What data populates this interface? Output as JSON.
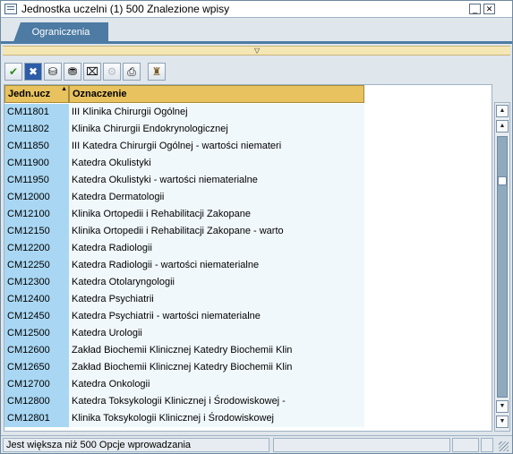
{
  "window": {
    "title": "Jednostka uczelni (1)  500 Znalezione wpisy",
    "minimize_glyph": "_",
    "close_glyph": "✕"
  },
  "tabs": [
    {
      "label": "Ograniczenia"
    }
  ],
  "collapse_bar": {
    "arrow_glyph": "▽"
  },
  "toolbar": {
    "buttons": [
      {
        "icon": "checkmark-icon",
        "glyph": "✔"
      },
      {
        "icon": "cancel-icon",
        "glyph": "✖"
      },
      {
        "icon": "find-icon",
        "glyph": "⛁"
      },
      {
        "icon": "find-next-icon",
        "glyph": "⛃"
      },
      {
        "icon": "delete-selection-icon",
        "glyph": "⌧"
      },
      {
        "icon": "info-icon",
        "glyph": "⚙"
      },
      {
        "icon": "print-icon",
        "glyph": "⎙"
      },
      {
        "icon": "personalize-icon",
        "glyph": "♜"
      }
    ]
  },
  "table": {
    "columns": [
      "Jedn.ucz",
      "Oznaczenie"
    ],
    "rows": [
      [
        "CM11801",
        "III Klinika Chirurgii Ogólnej"
      ],
      [
        "CM11802",
        "Klinika Chirurgii Endokrynologicznej"
      ],
      [
        "CM11850",
        "III Katedra Chirurgii Ogólnej - wartości niemateri"
      ],
      [
        "CM11900",
        "Katedra Okulistyki"
      ],
      [
        "CM11950",
        "Katedra Okulistyki - wartości niematerialne"
      ],
      [
        "CM12000",
        "Katedra Dermatologii"
      ],
      [
        "CM12100",
        "Klinika Ortopedii i Rehabilitacji Zakopane"
      ],
      [
        "CM12150",
        "Klinika Ortopedii i Rehabilitacji Zakopane - warto"
      ],
      [
        "CM12200",
        "Katedra Radiologii"
      ],
      [
        "CM12250",
        "Katedra Radiologii - wartości niematerialne"
      ],
      [
        "CM12300",
        "Katedra Otolaryngologii"
      ],
      [
        "CM12400",
        "Katedra Psychiatrii"
      ],
      [
        "CM12450",
        "Katedra Psychiatrii - wartości niematerialne"
      ],
      [
        "CM12500",
        "Katedra Urologii"
      ],
      [
        "CM12600",
        "Zakład Biochemii Klinicznej Katedry Biochemii Klin"
      ],
      [
        "CM12650",
        "Zakład Biochemii Klinicznej Katedry Biochemii Klin"
      ],
      [
        "CM12700",
        "Katedra Onkologii"
      ],
      [
        "CM12800",
        "Katedra Toksykologii Klinicznej i Środowiskowej -"
      ],
      [
        "CM12801",
        "Klinika Toksykologii Klinicznej i Środowiskowej"
      ]
    ]
  },
  "scrollbar": {
    "top_glyph": "▲",
    "up_glyph": "▲",
    "down_glyph": "▼",
    "bottom_glyph": "▼"
  },
  "status": {
    "message": "Jest większa niż  500 Opcje wprowadzania"
  },
  "colors": {
    "tab_bg": "#4d7ba3",
    "header_bg": "#e7c25e",
    "key_column_bg": "#a9d7f3",
    "text_column_bg": "#f1f8fc"
  }
}
